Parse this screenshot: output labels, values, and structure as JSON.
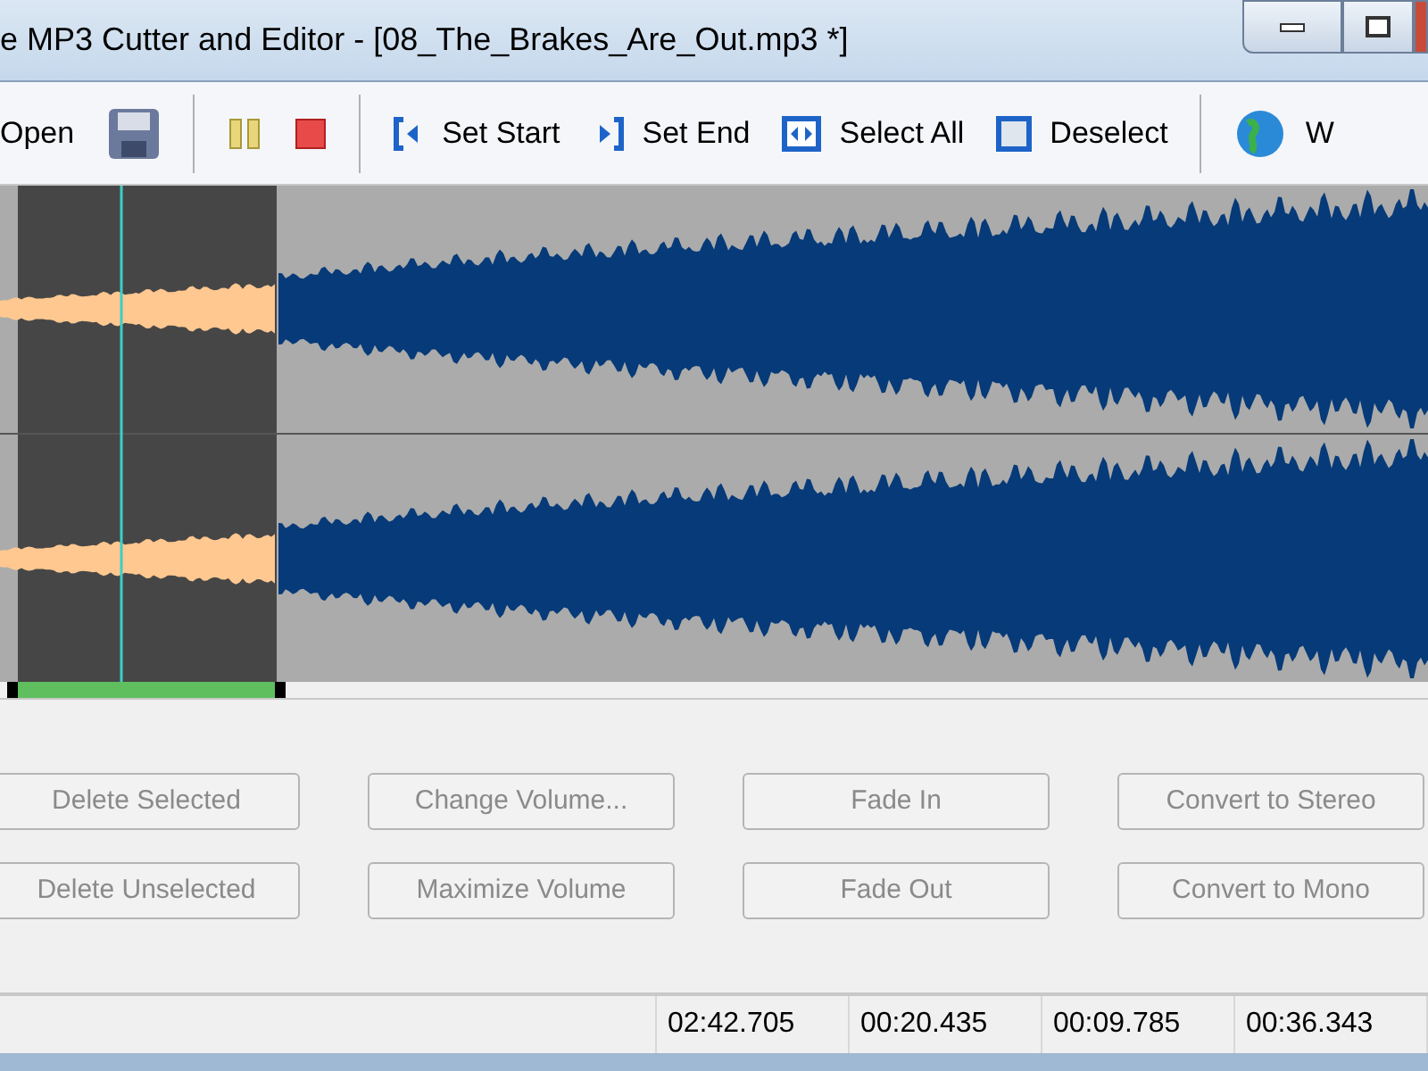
{
  "window": {
    "title": "e MP3 Cutter and Editor - [08_The_Brakes_Are_Out.mp3 *]"
  },
  "toolbar": [
    {
      "kind": "button",
      "label": "Open"
    },
    {
      "kind": "icon"
    },
    {
      "kind": "separator"
    },
    {
      "kind": "icon"
    },
    {
      "kind": "icon"
    },
    {
      "kind": "separator"
    },
    {
      "kind": "button",
      "label": "Set Start"
    },
    {
      "kind": "button",
      "label": "Set End"
    },
    {
      "kind": "button",
      "label": "Select All"
    },
    {
      "kind": "button",
      "label": "Deselect"
    },
    {
      "kind": "separator"
    },
    {
      "kind": "button",
      "label": "W"
    }
  ],
  "buttons": [
    [
      {
        "label": "Delete Selected",
        "disabled": true
      },
      {
        "label": "Delete Unselected",
        "disabled": true
      }
    ],
    [
      {
        "label": "Change Volume...",
        "disabled": true
      },
      {
        "label": "Maximize Volume",
        "disabled": true
      }
    ],
    [
      {
        "label": "Fade In",
        "disabled": true
      },
      {
        "label": "Fade Out",
        "disabled": true
      }
    ],
    [
      {
        "label": "Convert to Stereo",
        "disabled": true
      },
      {
        "label": "Convert to Mono",
        "disabled": true
      }
    ]
  ],
  "status_bar": [
    "02:42.705",
    "00:20.435",
    "00:09.785",
    "00:36.343"
  ]
}
